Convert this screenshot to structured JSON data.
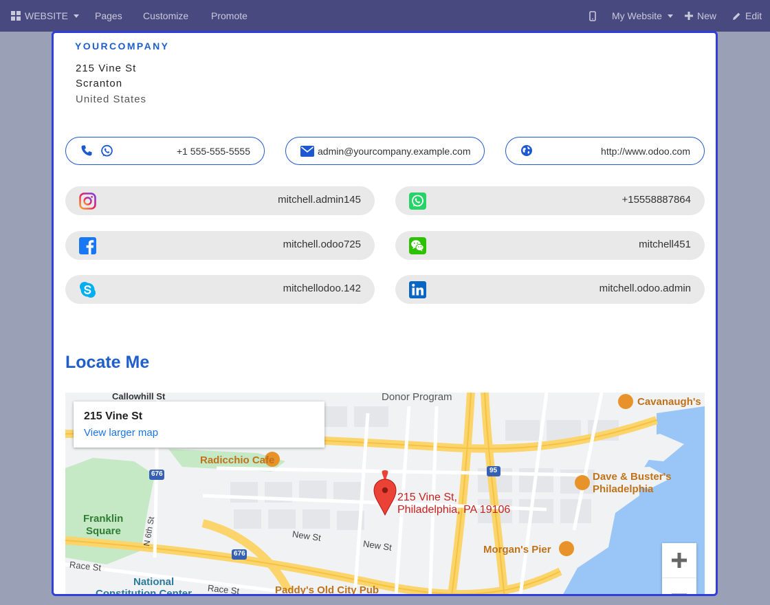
{
  "navbar": {
    "app_label": "WEBSITE",
    "pages_label": "Pages",
    "customize_label": "Customize",
    "promote_label": "Promote",
    "site_selector_label": "My Website",
    "new_label": "New",
    "edit_label": "Edit"
  },
  "company": {
    "name": "YOURCOMPANY",
    "address_line1": "215 Vine St",
    "address_line2": "Scranton",
    "country": "United States"
  },
  "contacts": {
    "phone": "+1 555-555-5555",
    "email": "admin@yourcompany.example.com",
    "website": "http://www.odoo.com"
  },
  "social": [
    {
      "network": "instagram-icon",
      "handle": "mitchell.admin145"
    },
    {
      "network": "whatsapp-icon",
      "handle": "+15558887864"
    },
    {
      "network": "facebook-icon",
      "handle": "mitchell.odoo725"
    },
    {
      "network": "wechat-icon",
      "handle": "mitchell451"
    },
    {
      "network": "skype-icon",
      "handle": "mitchellodoo.142"
    },
    {
      "network": "linkedin-icon",
      "handle": "mitchell.odoo.admin"
    }
  ],
  "locate": {
    "heading": "Locate Me"
  },
  "map": {
    "card_title": "215 Vine St",
    "card_link": "View larger map",
    "pin_label_line1": "215 Vine St,",
    "pin_label_line2": "Philadelphia, PA 19106",
    "places": {
      "callowhill": "Callowhill St",
      "donor": "Donor Program",
      "cavanaugh": "Cavanaugh's",
      "radicchio": "Radicchio Cafe",
      "franklin1": "Franklin",
      "franklin2": "Square",
      "n6th": "N 6th St",
      "new_st1": "New St",
      "new_st2": "New St",
      "race1": "Race St",
      "race2": "Race St",
      "national1": "National",
      "national2": "Constitution Center",
      "paddys": "Paddy's Old City Pub",
      "dave1": "Dave & Buster's",
      "dave2": "Philadelphia",
      "morgans": "Morgan's Pier",
      "i676a": "676",
      "i676b": "676",
      "i95": "95"
    },
    "colors": {
      "water": "#99c6f7",
      "park": "#c5e8c5",
      "highway": "#fbd56b",
      "road": "#ffffff",
      "poi": "#e8932a",
      "pin": "#ea4335"
    }
  }
}
